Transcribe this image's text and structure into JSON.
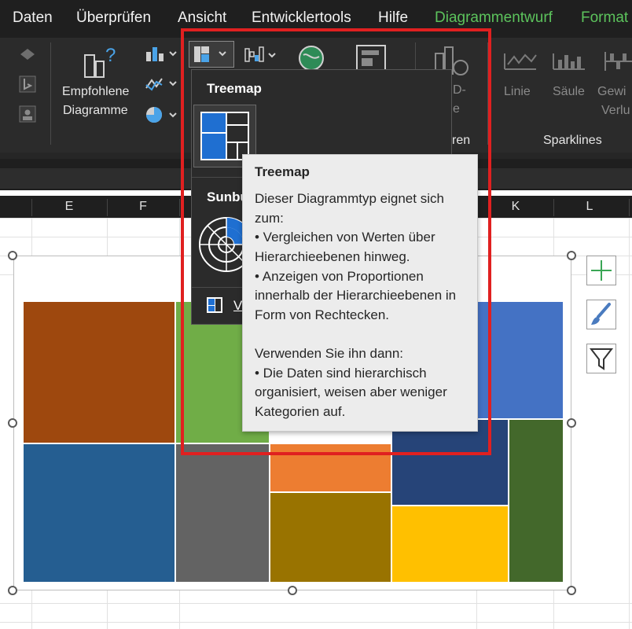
{
  "menu": [
    "Daten",
    "Überprüfen",
    "Ansicht",
    "Entwicklertools",
    "Hilfe",
    "Diagrammentwurf",
    "Format"
  ],
  "ribbon": {
    "recommended": [
      "Empfohlene",
      "Diagramme"
    ],
    "sparklines_group": "Sparklines",
    "sparkline_line": "Linie",
    "sparkline_column": "Säule",
    "sparkline_winloss": [
      "Gewi",
      "Verlu"
    ],
    "group_label_partial": "ren",
    "three_d_partial": [
      "D-",
      "e"
    ]
  },
  "columns": [
    "E",
    "F",
    "K",
    "L"
  ],
  "dropdown": {
    "treemap_heading": "Treemap",
    "sunburst_heading": "Sunbu",
    "more_link": "V"
  },
  "tooltip": {
    "title": "Treemap",
    "lines": [
      "Dieser Diagrammtyp eignet sich",
      "zum:",
      "• Vergleichen von Werten über",
      "Hierarchieebenen hinweg.",
      "• Anzeigen von Proportionen",
      "innerhalb der Hierarchieebenen in",
      "Form von Rechtecken.",
      "",
      "Verwenden Sie ihn dann:",
      "• Die Daten sind hierarchisch",
      "organisiert, weisen aber weniger",
      "Kategorien auf."
    ]
  },
  "colors": {
    "highlight": "#e02020",
    "context_tab": "#5cc35c",
    "tiles": [
      "#9e480e",
      "#70ad47",
      "#4472c4",
      "#255e91",
      "#636363",
      "#ed7d31",
      "#997300",
      "#264478",
      "#ffc000",
      "#43682b"
    ]
  },
  "icons": [
    "treemap-icon",
    "sunburst-icon",
    "globe-map-icon",
    "pivot-chart-icon",
    "bar-chart-icon",
    "line-chart-icon",
    "pie-chart-icon",
    "waterfall-icon",
    "add-element-icon",
    "brush-icon",
    "filter-icon"
  ]
}
